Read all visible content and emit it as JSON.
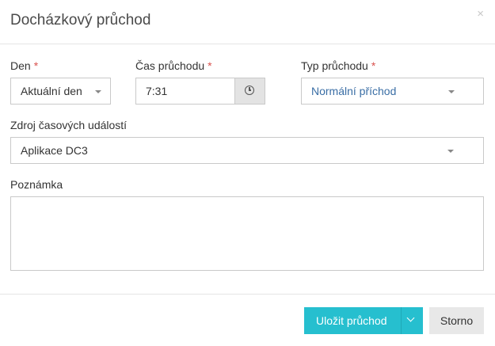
{
  "dialog": {
    "title": "Docházkový průchod",
    "close_icon": "×"
  },
  "form": {
    "den": {
      "label": "Den",
      "required_mark": "*",
      "value": "Aktuální den"
    },
    "cas": {
      "label": "Čas průchodu",
      "required_mark": "*",
      "value": "7:31",
      "icon": "clock-icon"
    },
    "typ": {
      "label": "Typ průchodu",
      "required_mark": "*",
      "value": "Normální příchod",
      "value_color": "#3a6ea5"
    },
    "zdroj": {
      "label": "Zdroj časových událostí",
      "value": "Aplikace DC3"
    },
    "poznamka": {
      "label": "Poznámka",
      "value": ""
    }
  },
  "footer": {
    "save_label": "Uložit průchod",
    "cancel_label": "Storno"
  },
  "colors": {
    "primary": "#26bfcf",
    "required": "#d9534f"
  }
}
